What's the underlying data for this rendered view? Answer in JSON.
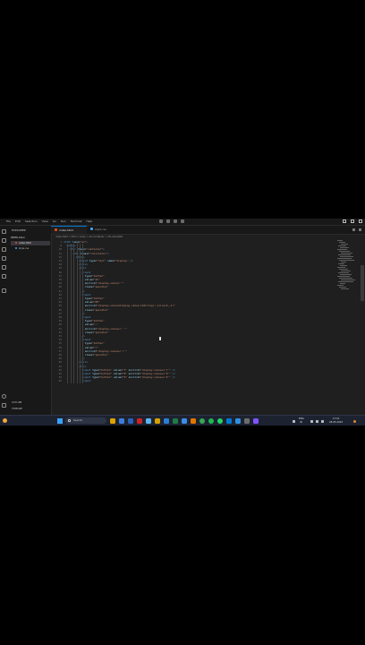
{
  "menu": [
    "File",
    "Edit",
    "Selection",
    "View",
    "Go",
    "Run",
    "Terminal",
    "Help"
  ],
  "explorer": {
    "title": "EXPLORER",
    "project": "DEMO-CALC",
    "files": [
      {
        "name": "index.html",
        "active": true,
        "color": "#e44d26"
      },
      {
        "name": "style.css",
        "active": false,
        "color": "#42a5f5"
      }
    ],
    "outline_label": "OUTLINE",
    "timeline_label": "TIMELINE"
  },
  "tabs": [
    {
      "name": "index.html",
      "active": true,
      "color": "#e44d26"
    },
    {
      "name": "style.css",
      "active": false,
      "color": "#42a5f5"
    }
  ],
  "breadcrumb": "index.html > html > body > div.container > div.calculator",
  "code_lines": [
    {
      "n": "1",
      "indent": 0,
      "text": "<html lang=\"en\">"
    },
    {
      "n": "8",
      "indent": 1,
      "text": "<body>"
    },
    {
      "n": "10",
      "indent": 2,
      "text": "<div class=\"container\">"
    },
    {
      "n": "11",
      "indent": 3,
      "text": "<div class=\"calculator\">"
    },
    {
      "n": "12",
      "indent": 4,
      "text": "<form>"
    },
    {
      "n": "13",
      "indent": 5,
      "text": "<input type=\"text\" name=\"display\" />"
    },
    {
      "n": "14",
      "indent": 5,
      "text": "</div>"
    },
    {
      "n": "15",
      "indent": 5,
      "text": "<div>"
    },
    {
      "n": "16",
      "indent": 6,
      "text": "<input"
    },
    {
      "n": "17",
      "indent": 7,
      "text": "type=\"button\""
    },
    {
      "n": "18",
      "indent": 7,
      "text": "value=\"AC\""
    },
    {
      "n": "19",
      "indent": 7,
      "text": "onclick=\"display.value=''\""
    },
    {
      "n": "20",
      "indent": 7,
      "text": "class=\"operator\""
    },
    {
      "n": "21",
      "indent": 6,
      "text": "/>"
    },
    {
      "n": "22",
      "indent": 6,
      "text": "<input"
    },
    {
      "n": "23",
      "indent": 7,
      "text": "type=\"button\""
    },
    {
      "n": "24",
      "indent": 7,
      "text": "value=\"DE\""
    },
    {
      "n": "25",
      "indent": 7,
      "text": "onclick=\"display.value=display.value.toString().slice(0,-1)\""
    },
    {
      "n": "26",
      "indent": 7,
      "text": "class=\"operator\""
    },
    {
      "n": "27",
      "indent": 6,
      "text": "/>"
    },
    {
      "n": "28",
      "indent": 6,
      "text": "<input"
    },
    {
      "n": "29",
      "indent": 7,
      "text": "type=\"button\""
    },
    {
      "n": "30",
      "indent": 7,
      "text": "value=\".\""
    },
    {
      "n": "31",
      "indent": 7,
      "text": "onclick=\"display.value+='.'\""
    },
    {
      "n": "32",
      "indent": 7,
      "text": "class=\"operator\""
    },
    {
      "n": "33",
      "indent": 6,
      "text": "/>"
    },
    {
      "n": "34",
      "indent": 6,
      "text": "<input"
    },
    {
      "n": "35",
      "indent": 7,
      "text": "type=\"button\""
    },
    {
      "n": "36",
      "indent": 7,
      "text": "value=\"/\""
    },
    {
      "n": "37",
      "indent": 7,
      "text": "onclick=\"display.value+='/'\""
    },
    {
      "n": "38",
      "indent": 7,
      "text": "class=\"operator\""
    },
    {
      "n": "39",
      "indent": 6,
      "text": "/>"
    },
    {
      "n": "40",
      "indent": 5,
      "text": "</div>"
    },
    {
      "n": "41",
      "indent": 5,
      "text": "<div>"
    },
    {
      "n": "42",
      "indent": 6,
      "text": "<input type=\"button\" value=\"7\" onclick=\"display.value+='7'\" />"
    },
    {
      "n": "43",
      "indent": 6,
      "text": "<input type=\"button\" value=\"8\" onclick=\"display.value+='8'\" />"
    },
    {
      "n": "44",
      "indent": 6,
      "text": "<input type=\"button\" value=\"9\" onclick=\"display.value+='9'\" />"
    },
    {
      "n": "45",
      "indent": 6,
      "text": "<input"
    }
  ],
  "taskbar": {
    "search_label": "Search",
    "language": "ENG",
    "region": "IN",
    "time": "17:01",
    "date": "28-05-2024"
  },
  "colors": {
    "accent": "#0078d4",
    "tag": "#569cd6",
    "attr": "#9cdcfe",
    "string": "#ce9178"
  }
}
